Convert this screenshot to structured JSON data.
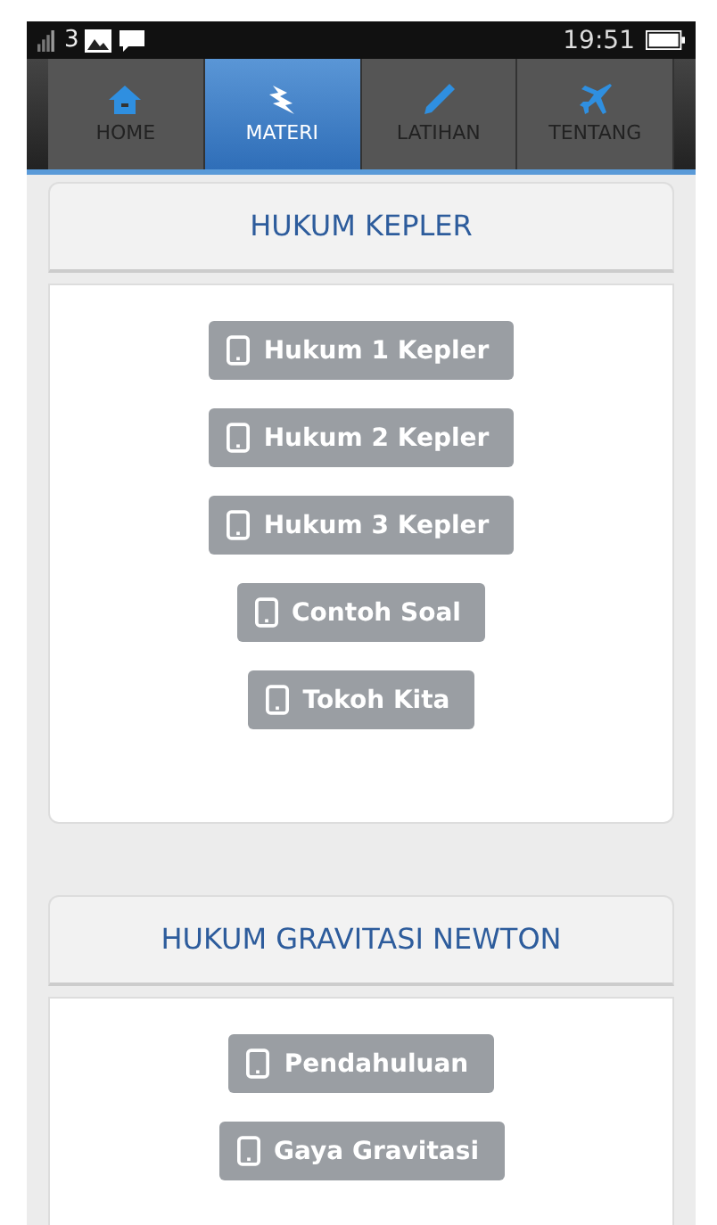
{
  "status_bar": {
    "carrier": "3",
    "time": "19:51"
  },
  "tabs": [
    {
      "label": "HOME",
      "kind": "home",
      "selected": false
    },
    {
      "label": "MATERI",
      "kind": "bolt",
      "selected": true
    },
    {
      "label": "LATIHAN",
      "kind": "pen",
      "selected": false
    },
    {
      "label": "TENTANG",
      "kind": "plane",
      "selected": false
    }
  ],
  "sections": [
    {
      "title": "HUKUM KEPLER",
      "buttons": [
        "Hukum 1 Kepler",
        "Hukum 2 Kepler",
        "Hukum 3 Kepler",
        "Contoh Soal",
        "Tokoh Kita"
      ]
    },
    {
      "title": "HUKUM GRAVITASI NEWTON",
      "buttons": [
        "Pendahuluan",
        "Gaya Gravitasi"
      ]
    }
  ]
}
